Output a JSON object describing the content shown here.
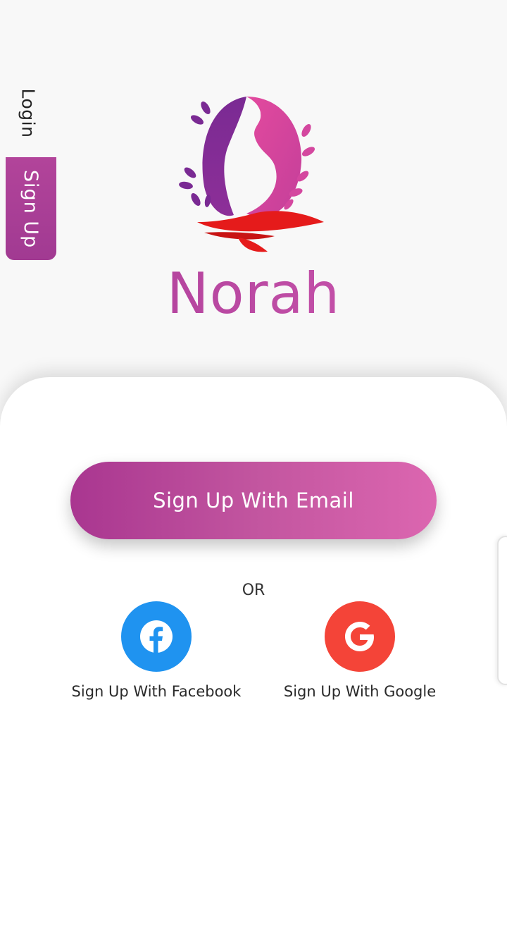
{
  "side_tabs": {
    "login_label": "Login",
    "signup_label": "Sign Up",
    "active": "signup"
  },
  "brand": {
    "name": "Norah"
  },
  "actions": {
    "email_button_label": "Sign Up With Email",
    "or_label": "OR",
    "facebook_label": "Sign Up With Facebook",
    "google_label": "Sign Up With Google"
  },
  "icons": {
    "facebook": "facebook-icon",
    "google": "google-icon",
    "logo": "pregnant-woman-logo-icon"
  },
  "colors": {
    "accent_purple": "#a93690",
    "accent_pink": "#dc66b0",
    "facebook_blue": "#1f93f0",
    "google_red": "#f44438",
    "logo_red": "#e51b1b"
  }
}
